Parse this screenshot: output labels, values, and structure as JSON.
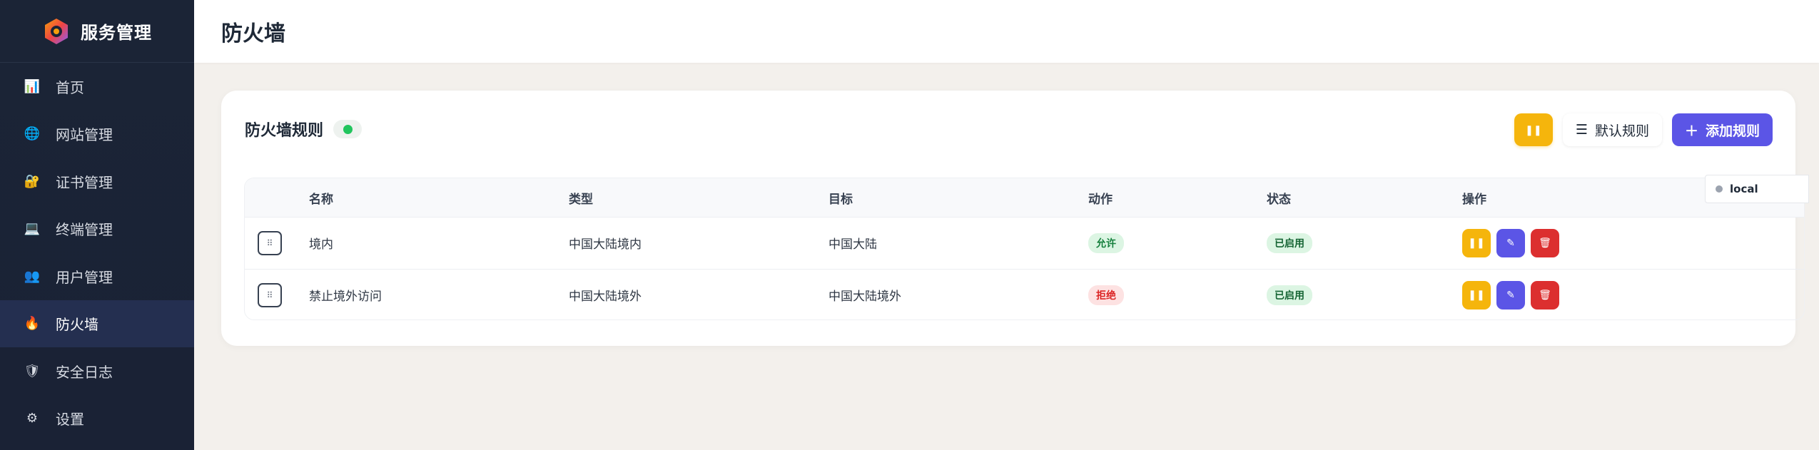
{
  "app": {
    "title": "服务管理"
  },
  "sidebar": {
    "items": [
      {
        "label": "首页",
        "icon": "chart-icon",
        "glyph": "📊"
      },
      {
        "label": "网站管理",
        "icon": "globe-icon",
        "glyph": "🌐"
      },
      {
        "label": "证书管理",
        "icon": "lock-icon",
        "glyph": "🔐"
      },
      {
        "label": "终端管理",
        "icon": "laptop-icon",
        "glyph": "💻"
      },
      {
        "label": "用户管理",
        "icon": "users-icon",
        "glyph": "👥"
      },
      {
        "label": "防火墙",
        "icon": "fire-icon",
        "glyph": "🔥",
        "active": true
      },
      {
        "label": "安全日志",
        "icon": "shield-icon",
        "glyph": "🛡"
      },
      {
        "label": "设置",
        "icon": "gear-icon",
        "glyph": "⚙"
      }
    ]
  },
  "header": {
    "title": "防火墙"
  },
  "card": {
    "title": "防火墙规则",
    "status_color": "#22c55e"
  },
  "toolbar": {
    "pause_icon": "pause-icon",
    "default_rules_label": "默认规则",
    "default_rules_icon": "list-icon",
    "add_rule_label": "添加规则",
    "add_rule_icon": "plus-icon"
  },
  "table": {
    "headers": [
      "名称",
      "类型",
      "目标",
      "动作",
      "状态",
      "操作"
    ],
    "rows": [
      {
        "name": "境内",
        "type": "中国大陆境内",
        "target": "中国大陆",
        "action": "允许",
        "action_kind": "allow",
        "status": "已启用"
      },
      {
        "name": "禁止境外访问",
        "type": "中国大陆境外",
        "target": "中国大陆境外",
        "action": "拒绝",
        "action_kind": "deny",
        "status": "已启用"
      }
    ]
  },
  "colors": {
    "allow_bg": "#dcf5e3",
    "allow_fg": "#15803d",
    "deny_bg": "#fde2e2",
    "deny_fg": "#dc2626",
    "enabled_bg": "#dcf5e3",
    "enabled_fg": "#166534",
    "accent": "#5b55e6",
    "warning": "#f5b50c",
    "danger": "#dc2f2f"
  },
  "local_tag": {
    "label": "local"
  }
}
